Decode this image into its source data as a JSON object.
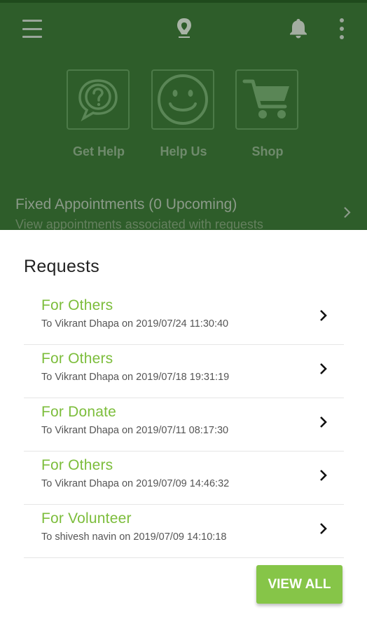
{
  "background": {
    "tiles": [
      {
        "label": "Get Help",
        "icon": "help-bubble-icon"
      },
      {
        "label": "Help Us",
        "icon": "smiley-icon"
      },
      {
        "label": "Shop",
        "icon": "cart-icon"
      }
    ],
    "appointments": {
      "title": "Fixed Appointments (0 Upcoming)",
      "subtitle": "View appointments associated with requests"
    }
  },
  "sheet": {
    "title": "Requests",
    "items": [
      {
        "title": "For Others",
        "subtitle": "To Vikrant Dhapa on 2019/07/24 11:30:40"
      },
      {
        "title": "For Others",
        "subtitle": "To Vikrant Dhapa on 2019/07/18 19:31:19"
      },
      {
        "title": "For Donate",
        "subtitle": "To Vikrant Dhapa on 2019/07/11 08:17:30"
      },
      {
        "title": "For Others",
        "subtitle": "To Vikrant Dhapa on 2019/07/09 14:46:32"
      },
      {
        "title": "For Volunteer",
        "subtitle": "To shivesh navin on 2019/07/09 14:10:18"
      }
    ],
    "view_all_label": "VIEW ALL"
  },
  "colors": {
    "accent": "#86c548",
    "item_title": "#7cbd3b",
    "scrim_background": "#2e5d2a"
  }
}
